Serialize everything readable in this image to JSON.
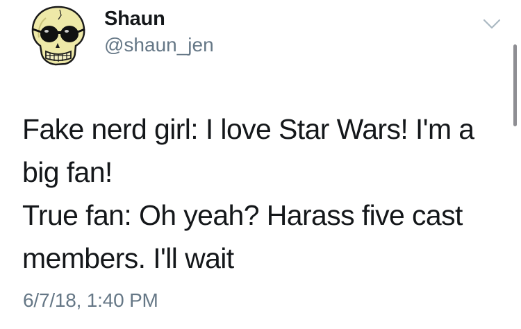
{
  "author": {
    "display_name": "Shaun",
    "handle": "@shaun_jen",
    "avatar_icon": "skull-sunglasses-icon"
  },
  "tweet": {
    "lines": [
      "Fake nerd girl: I love Star Wars! I'm a",
      "big fan!",
      "True fan: Oh yeah? Harass five cast",
      "members. I'll wait"
    ],
    "timestamp": "6/7/18, 1:40 PM"
  },
  "controls": {
    "menu_icon": "chevron-down-icon"
  },
  "colors": {
    "text_primary": "#14171a",
    "text_secondary": "#657786",
    "caret": "#aab8c2",
    "avatar_skull": "#eee9a8"
  }
}
